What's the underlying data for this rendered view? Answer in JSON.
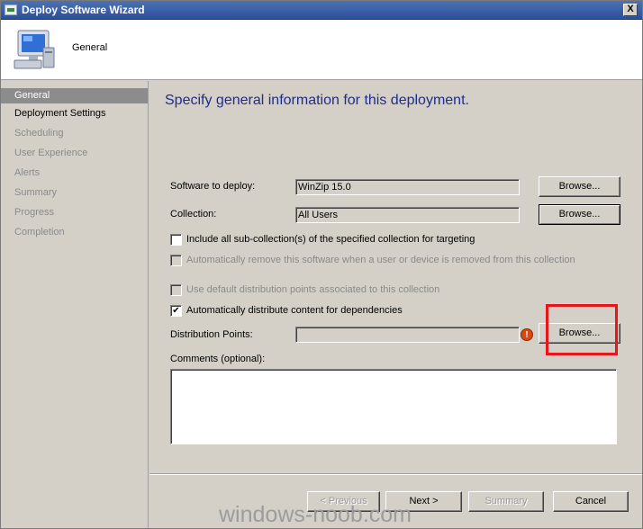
{
  "window": {
    "title": "Deploy Software Wizard",
    "close_glyph": "X"
  },
  "header": {
    "title": "General"
  },
  "nav": {
    "items": [
      {
        "label": "General",
        "state": "active"
      },
      {
        "label": "Deployment Settings",
        "state": "visited"
      },
      {
        "label": "Scheduling",
        "state": "pending"
      },
      {
        "label": "User Experience",
        "state": "pending"
      },
      {
        "label": "Alerts",
        "state": "pending"
      },
      {
        "label": "Summary",
        "state": "pending"
      },
      {
        "label": "Progress",
        "state": "pending"
      },
      {
        "label": "Completion",
        "state": "pending"
      }
    ]
  },
  "main": {
    "heading": "Specify general information for this deployment.",
    "software": {
      "label": "Software to deploy:",
      "value": "WinZip 15.0",
      "browse": "Browse..."
    },
    "collection": {
      "label": "Collection:",
      "value": "All Users",
      "browse": "Browse..."
    },
    "include_subcollections": {
      "label": "Include all sub-collection(s) of the specified collection for targeting",
      "checked": false
    },
    "auto_remove": {
      "label": "Automatically remove this software when a user or device is removed from this collection",
      "checked": false,
      "disabled": true
    },
    "default_dp": {
      "label": "Use default distribution points associated to this collection",
      "checked": false,
      "disabled": true
    },
    "auto_distribute": {
      "label": "Automatically distribute content for dependencies",
      "checked": true
    },
    "distribution_points": {
      "label": "Distribution Points:",
      "value": "",
      "browse": "Browse...",
      "warning_glyph": "!"
    },
    "comments": {
      "label": "Comments (optional):",
      "value": ""
    }
  },
  "footer": {
    "previous": "< Previous",
    "next": "Next >",
    "summary": "Summary",
    "cancel": "Cancel"
  },
  "watermark": "windows-noob.com",
  "colors": {
    "accent_heading": "#1f2d8c",
    "highlight": "#e8151b",
    "nav_active": "#8c8c8c"
  },
  "icons": [
    "computer-icon",
    "wizard-app-icon",
    "warning-icon",
    "scroll-up-icon",
    "scroll-down-icon"
  ]
}
